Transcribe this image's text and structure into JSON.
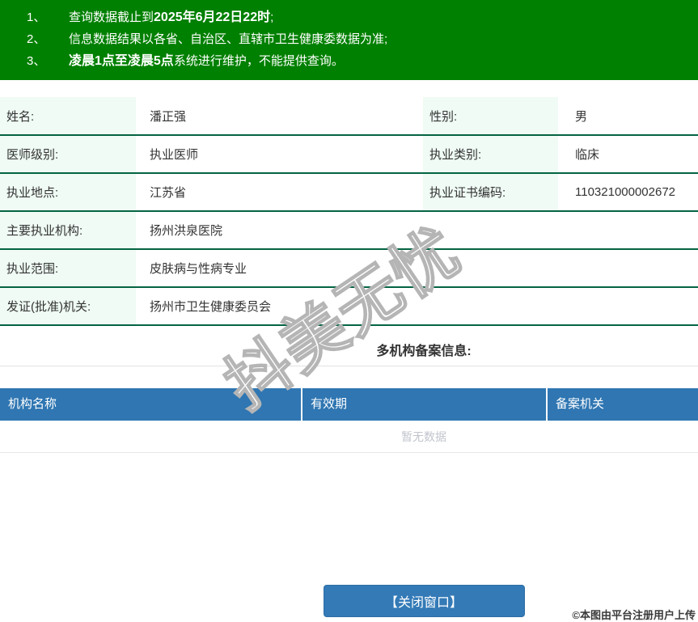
{
  "colors": {
    "banner_green": "#008000",
    "separator_green": "#046442",
    "label_mint": "#effbf4",
    "record_header_blue": "#2f76b2",
    "button_blue": "#337ab7",
    "empty_text_gray": "#c0c4cc"
  },
  "notice": {
    "items": [
      {
        "num": "1、",
        "pre": "查询数据截止到",
        "bold": "2025年6月22日22时",
        "post": ";"
      },
      {
        "num": "2、",
        "pre": "信息数据结果以各省、自治区、直辖市卫生健康委数据为准;",
        "bold": "",
        "post": ""
      },
      {
        "num": "3、",
        "pre": "",
        "bold": "凌晨1点至凌晨5点",
        "post": "系统进行维护，不能提供查询。"
      }
    ]
  },
  "info": {
    "rows": [
      {
        "l1": "姓名:",
        "v1": "潘正强",
        "l2": "性别:",
        "v2": "男"
      },
      {
        "l1": "医师级别:",
        "v1": "执业医师",
        "l2": "执业类别:",
        "v2": "临床"
      },
      {
        "l1": "执业地点:",
        "v1": "江苏省",
        "l2": "执业证书编码:",
        "v2": "110321000002672"
      },
      {
        "l1": "主要执业机构:",
        "v1": "扬州洪泉医院",
        "l2": "",
        "v2": ""
      },
      {
        "l1": "执业范围:",
        "v1": "皮肤病与性病专业",
        "l2": "",
        "v2": ""
      },
      {
        "l1": "发证(批准)机关:",
        "v1": "扬州市卫生健康委员会",
        "l2": "",
        "v2": ""
      }
    ]
  },
  "records": {
    "section_title": "多机构备案信息:",
    "headers": [
      "机构名称",
      "有效期",
      "备案机关"
    ],
    "empty_text": "暂无数据"
  },
  "footer": {
    "close_label": "【关闭窗口】"
  },
  "watermarks": {
    "diagonal": "抖美无忧",
    "bottom": "©本图由平台注册用户上传"
  }
}
